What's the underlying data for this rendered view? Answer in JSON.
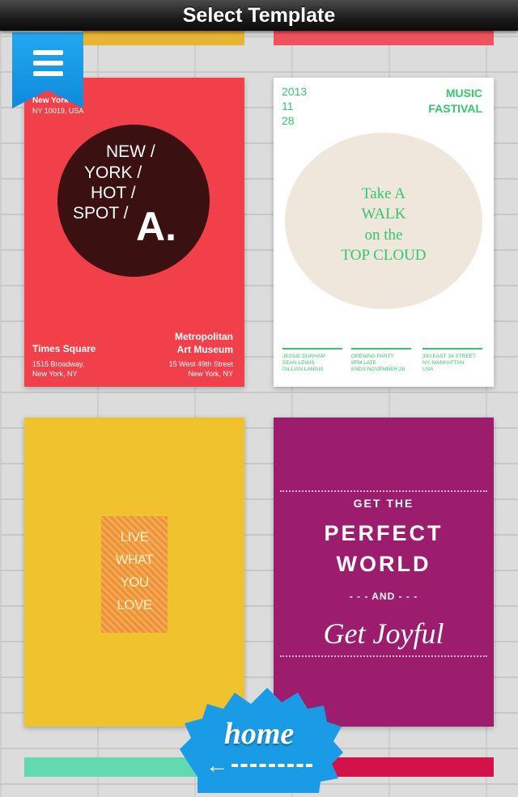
{
  "header": {
    "title": "Select Template"
  },
  "menu": {
    "icon": "menu-icon"
  },
  "templates": {
    "nyc": {
      "addr_top_line1": "New York",
      "addr_top_line2": "NY 10019, USA",
      "words": [
        "NEW /",
        "YORK  /",
        "HOT  /",
        "SPOT  /"
      ],
      "big_letter": "A.",
      "left_title": "Times Square",
      "left_sub1": "1515 Broadway,",
      "left_sub2": "New York, NY",
      "right_title1": "Metropolitan",
      "right_title2": "Art Museum",
      "right_sub1": "15 West 49th Street",
      "right_sub2": "New York, NY"
    },
    "walk": {
      "date": [
        "2013",
        "11",
        "28"
      ],
      "festival": [
        "MUSIC",
        "FASTIVAL"
      ],
      "lines": [
        "Take A",
        "WALK",
        "on the",
        "TOP CLOUD"
      ],
      "col1": [
        "JESSIE DURHAM",
        "SEAN LEWIS",
        "GILLIAN LANGIS"
      ],
      "col2": [
        "OPENING PARTY",
        "8PM LATE",
        "ENDS NOVEMBER 28"
      ],
      "col3": [
        "300 EAST 34 STREET",
        "NY, MANHATTAN",
        "USA"
      ]
    },
    "live": {
      "lines": [
        "LIVE",
        "WHAT",
        "YOU",
        "LOVE"
      ]
    },
    "world": {
      "line1": "GET THE",
      "line2": "PERFECT",
      "line3": "WORLD",
      "line4": "- - - AND - - -",
      "line5": "Get Joyful"
    }
  },
  "home": {
    "label": "home",
    "arrow_icon": "arrow-left-icon"
  },
  "colors": {
    "red": "#f2404a",
    "green": "#34c769",
    "yellow": "#f0c22e",
    "purple": "#9c1c6e",
    "blue": "#1a9be6",
    "teal": "#63d9b0",
    "crimson": "#d4124a"
  }
}
